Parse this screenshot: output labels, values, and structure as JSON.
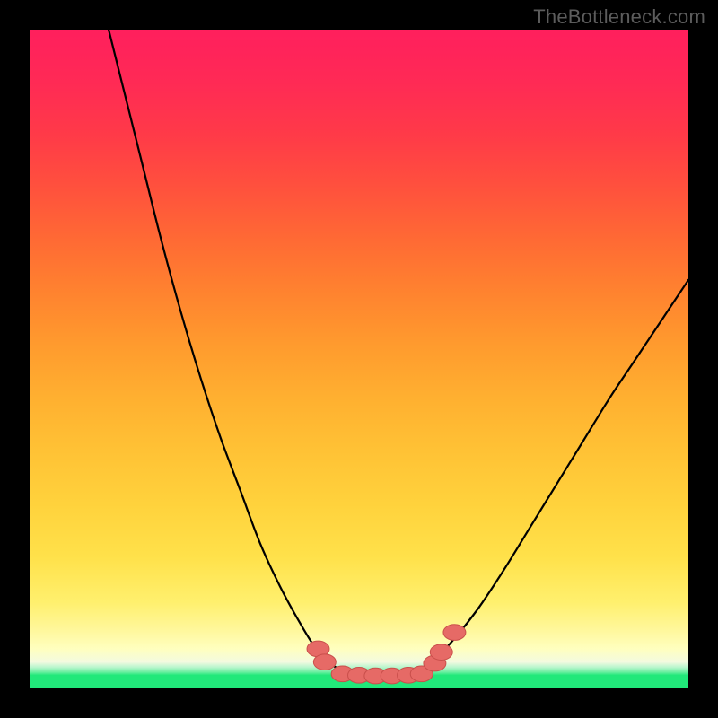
{
  "watermark": "TheBottleneck.com",
  "colors": {
    "background": "#000000",
    "curve_stroke": "#000000",
    "marker_fill": "#e66a66",
    "marker_stroke": "#c94f4b"
  },
  "chart_data": {
    "type": "line",
    "title": "",
    "xlabel": "",
    "ylabel": "",
    "xlim": [
      0,
      100
    ],
    "ylim": [
      0,
      100
    ],
    "grid": false,
    "curve": {
      "comment": "V-shaped curve; numbers are normalized 0–100 on each axis (origin bottom-left). Left branch falls steeply from top-left to the flat valley near y≈2; right branch rises more gently toward the upper-right.",
      "points": [
        {
          "x": 12.0,
          "y": 100.0
        },
        {
          "x": 14.0,
          "y": 92.0
        },
        {
          "x": 17.0,
          "y": 80.0
        },
        {
          "x": 20.0,
          "y": 68.0
        },
        {
          "x": 23.0,
          "y": 57.0
        },
        {
          "x": 26.0,
          "y": 47.0
        },
        {
          "x": 29.0,
          "y": 38.0
        },
        {
          "x": 32.0,
          "y": 30.0
        },
        {
          "x": 35.0,
          "y": 22.0
        },
        {
          "x": 38.0,
          "y": 15.5
        },
        {
          "x": 41.0,
          "y": 10.0
        },
        {
          "x": 43.5,
          "y": 6.0
        },
        {
          "x": 46.0,
          "y": 3.5
        },
        {
          "x": 49.0,
          "y": 2.2
        },
        {
          "x": 52.0,
          "y": 1.9
        },
        {
          "x": 55.0,
          "y": 2.0
        },
        {
          "x": 58.0,
          "y": 2.5
        },
        {
          "x": 61.0,
          "y": 4.0
        },
        {
          "x": 64.0,
          "y": 7.0
        },
        {
          "x": 68.0,
          "y": 12.0
        },
        {
          "x": 72.0,
          "y": 18.0
        },
        {
          "x": 76.0,
          "y": 24.5
        },
        {
          "x": 80.0,
          "y": 31.0
        },
        {
          "x": 84.0,
          "y": 37.5
        },
        {
          "x": 88.0,
          "y": 44.0
        },
        {
          "x": 92.0,
          "y": 50.0
        },
        {
          "x": 96.0,
          "y": 56.0
        },
        {
          "x": 100.0,
          "y": 62.0
        }
      ]
    },
    "markers": {
      "comment": "Salmon rounded markers clustered around the valley floor of the V-curve.",
      "rx": 1.7,
      "ry": 1.2,
      "points": [
        {
          "x": 43.8,
          "y": 6.0
        },
        {
          "x": 44.8,
          "y": 4.0
        },
        {
          "x": 47.5,
          "y": 2.2
        },
        {
          "x": 50.0,
          "y": 2.0
        },
        {
          "x": 52.5,
          "y": 1.9
        },
        {
          "x": 55.0,
          "y": 1.9
        },
        {
          "x": 57.5,
          "y": 2.0
        },
        {
          "x": 59.5,
          "y": 2.2
        },
        {
          "x": 61.5,
          "y": 3.8
        },
        {
          "x": 62.5,
          "y": 5.5
        },
        {
          "x": 64.5,
          "y": 8.5
        }
      ]
    }
  }
}
